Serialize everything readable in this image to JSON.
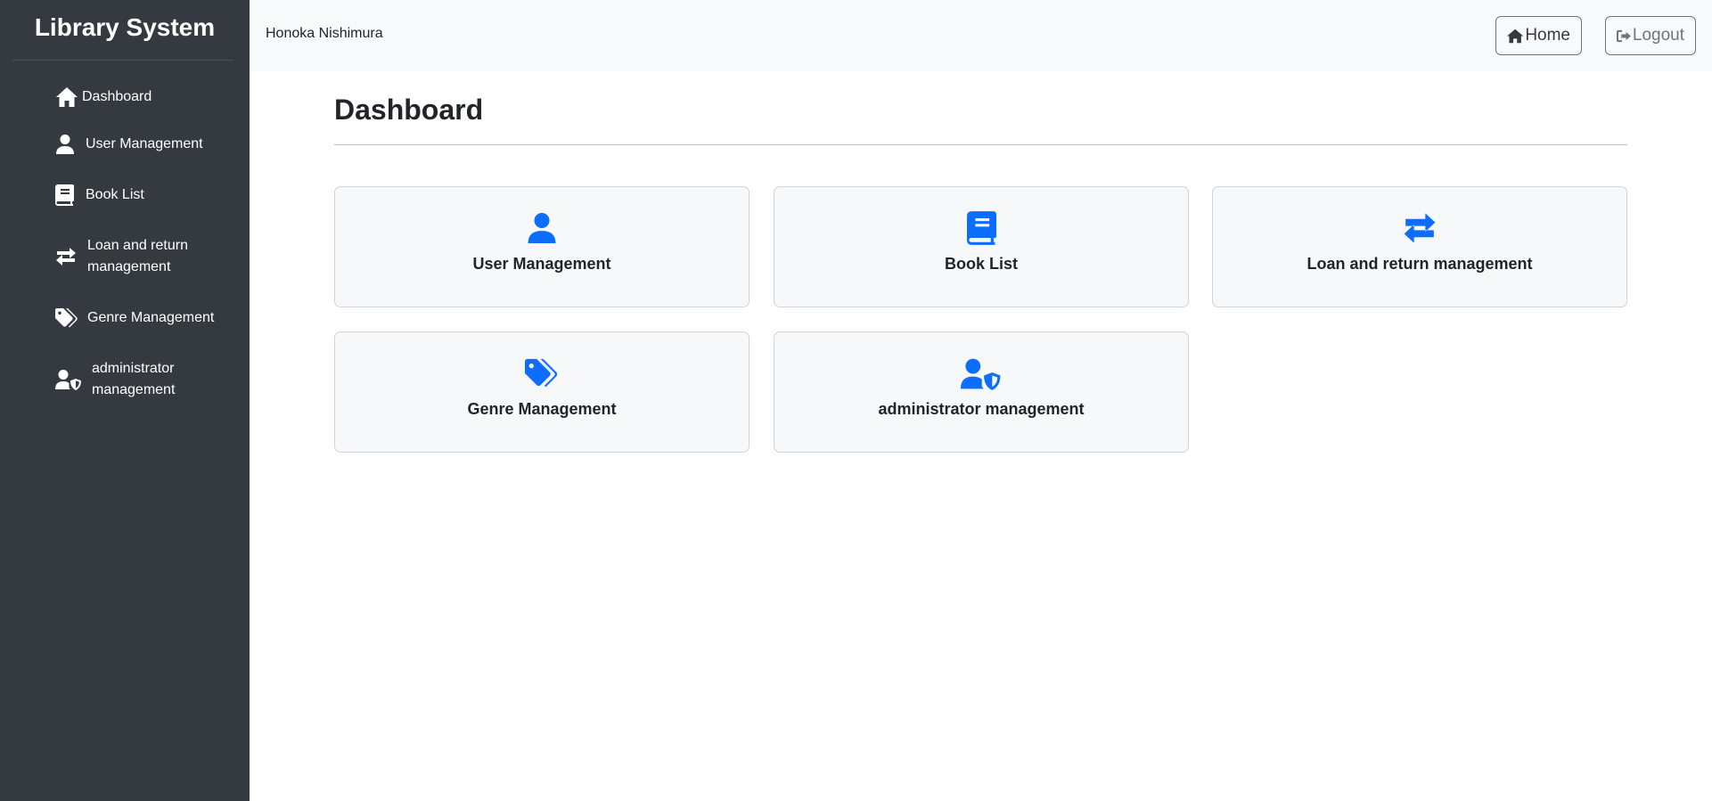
{
  "sidebar": {
    "brand": "Library System",
    "items": [
      {
        "label": "Dashboard",
        "icon": "house-icon"
      },
      {
        "label": "User Management",
        "icon": "person-icon"
      },
      {
        "label": "Book List",
        "icon": "book-icon"
      },
      {
        "label": "Loan and return management",
        "icon": "arrows-exchange-icon"
      },
      {
        "label": "Genre Management",
        "icon": "tags-icon"
      },
      {
        "label": "administrator management",
        "icon": "user-shield-icon"
      }
    ]
  },
  "topbar": {
    "user_name": "Honoka Nishimura",
    "home_label": "Home",
    "logout_label": "Logout"
  },
  "main": {
    "title": "Dashboard",
    "cards": [
      {
        "label": "User Management",
        "icon": "person-icon"
      },
      {
        "label": "Book List",
        "icon": "book-icon"
      },
      {
        "label": "Loan and return management",
        "icon": "arrows-exchange-icon"
      },
      {
        "label": "Genre Management",
        "icon": "tags-icon"
      },
      {
        "label": "administrator management",
        "icon": "user-shield-icon"
      }
    ]
  },
  "colors": {
    "sidebar_bg": "#343a40",
    "accent": "#0d6efd",
    "topbar_bg": "#f8f9fa"
  }
}
